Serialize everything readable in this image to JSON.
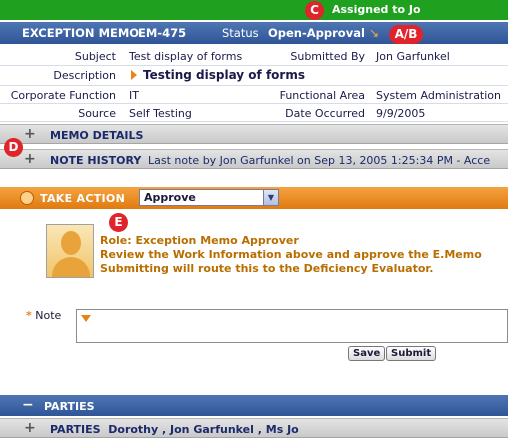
{
  "annotations": {
    "c": "C",
    "ab": "A/B",
    "d": "D",
    "e": "E"
  },
  "assigned": "Assigned to Jo",
  "header": {
    "title": "EXCEPTION MEMO",
    "id": "EM-475",
    "status_label": "Status",
    "status_value": "Open-Approval"
  },
  "details": {
    "subject_label": "Subject",
    "subject_value": "Test display of forms",
    "submitted_by_label": "Submitted By",
    "submitted_by_value": "Jon Garfunkel",
    "description_label": "Description",
    "description_value": "Testing display of forms",
    "corporate_function_label": "Corporate Function",
    "corporate_function_value": "IT",
    "functional_area_label": "Functional Area",
    "functional_area_value": "System Administration",
    "source_label": "Source",
    "source_value": "Self Testing",
    "date_occurred_label": "Date Occurred",
    "date_occurred_value": "9/9/2005"
  },
  "memo_details": {
    "label": "MEMO DETAILS"
  },
  "note_history": {
    "label": "NOTE HISTORY",
    "text": "Last note by Jon Garfunkel on Sep 13, 2005 1:25:34 PM - Acce"
  },
  "take_action": {
    "label": "TAKE ACTION",
    "selected": "Approve"
  },
  "role": {
    "line1": "Role: Exception Memo Approver",
    "line2": "Review the Work Information above and approve the E.Memo",
    "line3": "Submitting will route this to the Deficiency Evaluator."
  },
  "note": {
    "required_mark": "*",
    "label": "Note",
    "save": "Save",
    "submit": "Submit"
  },
  "parties": {
    "section_label": "PARTIES",
    "row_label": "PARTIES",
    "names": "Dorothy , Jon Garfunkel , Ms Jo"
  },
  "colors": {
    "green": "#1fa01f",
    "header_blue": "#2f5597",
    "action_orange": "#e07a10",
    "role_text": "#b86e00",
    "marker_red": "#e0242b"
  }
}
